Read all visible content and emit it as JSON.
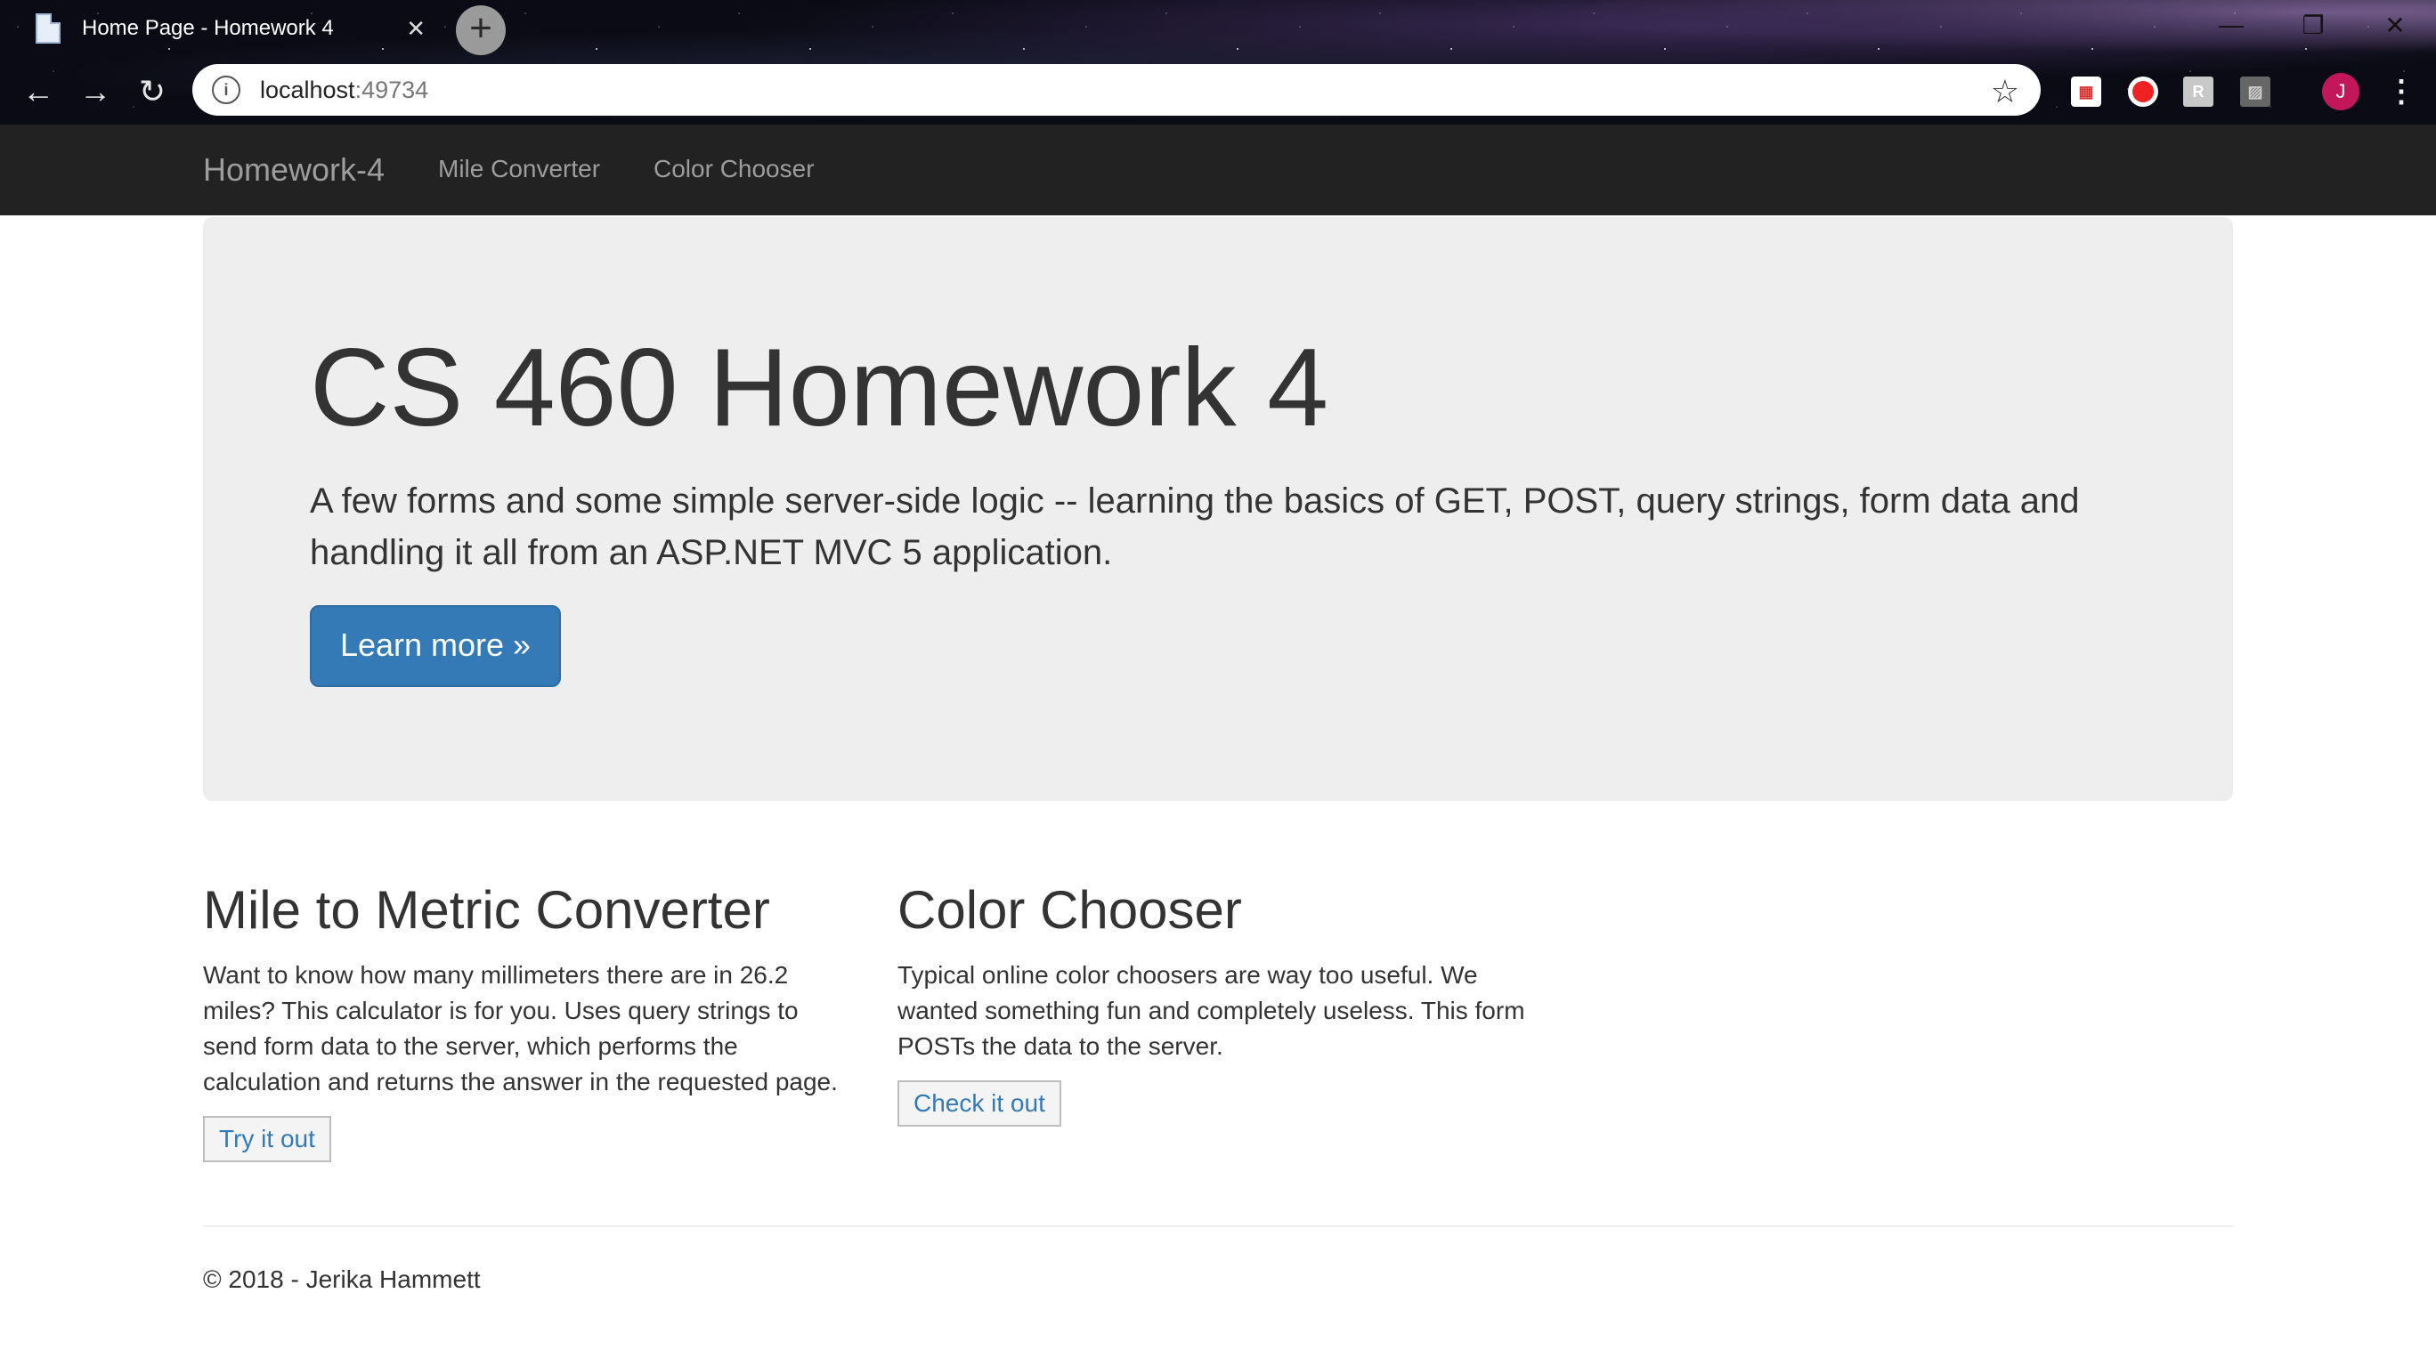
{
  "browser": {
    "tab_title": "Home Page - Homework 4",
    "tab_close": "✕",
    "new_tab": "+",
    "url_host": "localhost",
    "url_port": ":49734",
    "back_icon": "←",
    "forward_icon": "→",
    "reload_icon": "↻",
    "star_icon": "☆",
    "avatar_letter": "J",
    "menu_icon": "⋮",
    "minimize_icon": "—",
    "restore_icon": "❐",
    "close_icon": "✕",
    "reader_ext_label": "R"
  },
  "navbar": {
    "brand": "Homework-4",
    "links": [
      {
        "label": "Mile Converter"
      },
      {
        "label": "Color Chooser"
      }
    ]
  },
  "jumbotron": {
    "title": "CS 460 Homework 4",
    "lead": "A few forms and some simple server-side logic -- learning the basics of GET, POST, query strings, form data and handling it all from an ASP.NET MVC 5 application.",
    "button": "Learn more »"
  },
  "sections": [
    {
      "heading": "Mile to Metric Converter",
      "text": "Want to know how many millimeters there are in 26.2 miles? This calculator is for you. Uses query strings to send form data to the server, which performs the calculation and returns the answer in the requested page.",
      "button": "Try it out"
    },
    {
      "heading": "Color Chooser",
      "text": "Typical online color choosers are way too useful. We wanted something fun and completely useless. This form POSTs the data to the server.",
      "button": "Check it out"
    }
  ],
  "footer": {
    "text": "© 2018 - Jerika Hammett"
  },
  "colors": {
    "navbar_bg": "#222222",
    "primary": "#337ab7",
    "jumbotron_bg": "#eeeeee",
    "avatar": "#c2185b"
  }
}
